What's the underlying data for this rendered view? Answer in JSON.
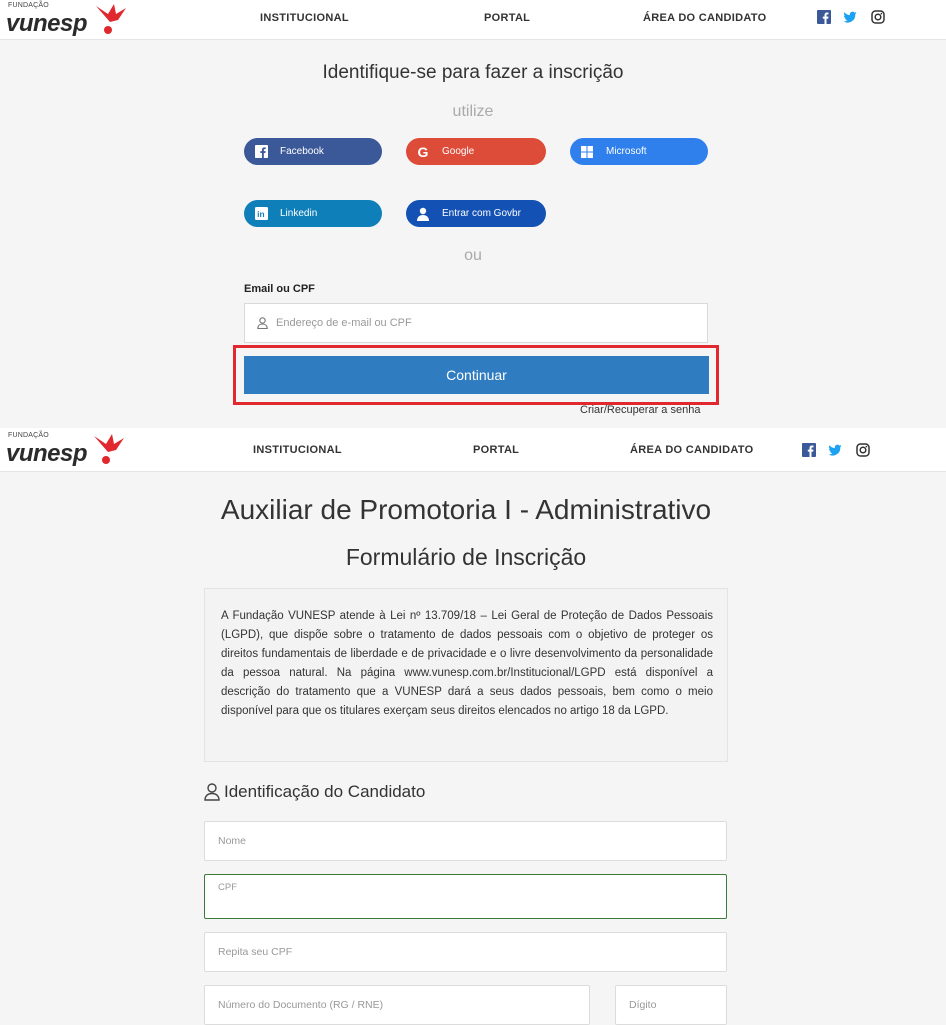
{
  "header": {
    "logo_small": "FUNDAÇÃO",
    "logo_big": "vunesp",
    "nav": [
      "INSTITUCIONAL",
      "PORTAL",
      "ÁREA DO CANDIDATO"
    ],
    "social_icons": [
      "facebook-icon",
      "twitter-icon",
      "instagram-icon"
    ]
  },
  "login": {
    "title": "Identifique-se para fazer a inscrição",
    "utilize": "utilize",
    "providers": [
      {
        "label": "Facebook",
        "color": "#3b5998"
      },
      {
        "label": "Google",
        "color": "#dd4b39"
      },
      {
        "label": "Microsoft",
        "color": "#2f80ed"
      },
      {
        "label": "Linkedin",
        "color": "#0e7fb8"
      },
      {
        "label": "Entrar com Govbr",
        "color": "#1351b4"
      }
    ],
    "ou": "ou",
    "email_label": "Email ou CPF",
    "email_placeholder": "Endereço de e-mail ou CPF",
    "continue_label": "Continuar",
    "recover_link": "Criar/Recuperar a senha",
    "highlight_color": "#e0282e"
  },
  "form": {
    "title": "Auxiliar de Promotoria I - Administrativo",
    "subtitle": "Formulário de Inscrição",
    "lgpd_text": "A Fundação VUNESP atende à Lei nº 13.709/18 – Lei Geral de Proteção de Dados Pessoais (LGPD), que dispõe sobre o tratamento de dados pessoais com o objetivo de proteger os direitos fundamentais de liberdade e de privacidade e o livre desenvolvimento da personalidade da pessoa natural. Na página www.vunesp.com.br/Institucional/LGPD está disponível a descrição do tratamento que a VUNESP dará a seus dados pessoais, bem como o meio disponível para que os titulares exerçam seus direitos elencados no artigo 18 da LGPD.",
    "section_title": "Identificação do Candidato",
    "fields": {
      "nome": "Nome",
      "cpf": "CPF",
      "cpf_repeat": "Repita seu CPF",
      "doc_number": "Número do Documento (RG / RNE)",
      "digit": "Dígito"
    },
    "active_field_color": "#3c7a3c"
  }
}
